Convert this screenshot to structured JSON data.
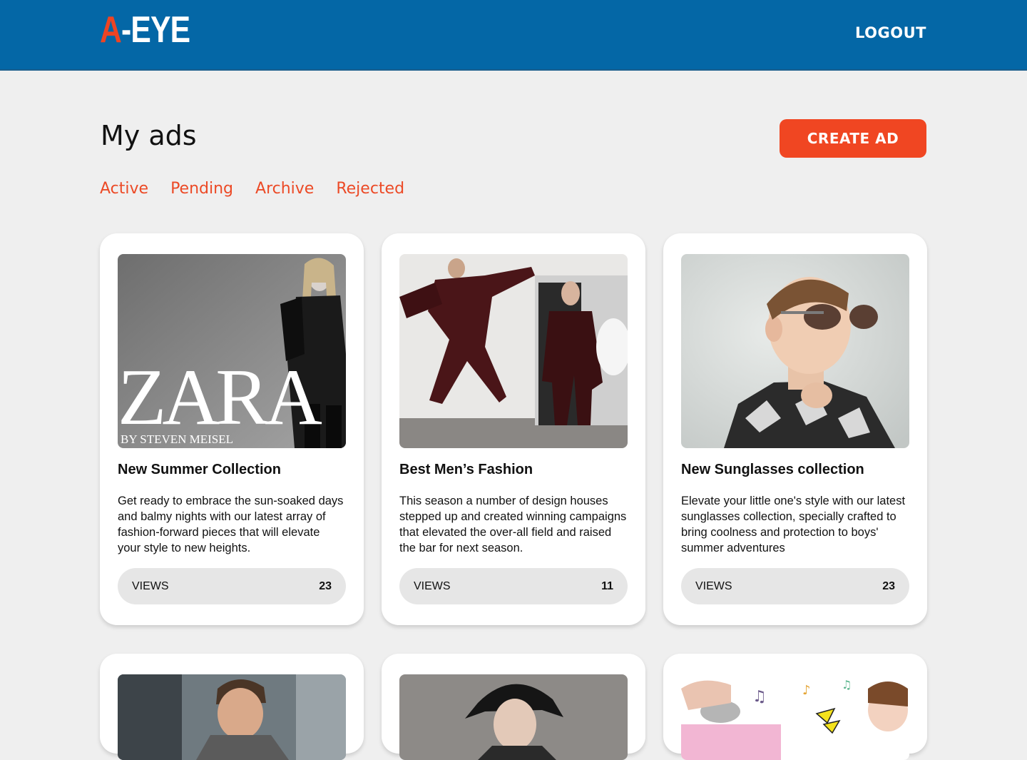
{
  "header": {
    "logo_a": "A",
    "logo_rest": "-EYE",
    "logout_label": "LOGOUT"
  },
  "main": {
    "title": "My ads",
    "create_label": "CREATE AD",
    "tabs": [
      "Active",
      "Pending",
      "Archive",
      "Rejected"
    ]
  },
  "ads": [
    {
      "image_text_brand": "ZARA",
      "image_text_credit": "BY STEVEN MEISEL",
      "title": "New Summer Collection",
      "description": "Get ready to embrace the sun-soaked days and balmy nights with our latest array of fashion-forward pieces that will elevate your style to new heights.",
      "views_label": "VIEWS",
      "views": "23"
    },
    {
      "title": "Best Men’s Fashion",
      "description": "This season a number of design houses stepped up and created winning campaigns that elevated the over-all field and raised the bar for next season.",
      "views_label": "VIEWS",
      "views": "11"
    },
    {
      "title": "New Sunglasses collection",
      "description": "Elevate your little one's style with our latest sunglasses collection, specially crafted to bring coolness and protection to boys' summer adventures",
      "views_label": "VIEWS",
      "views": "23"
    }
  ],
  "colors": {
    "header": "#0467a6",
    "accent": "#f04622",
    "background": "#efefef"
  }
}
